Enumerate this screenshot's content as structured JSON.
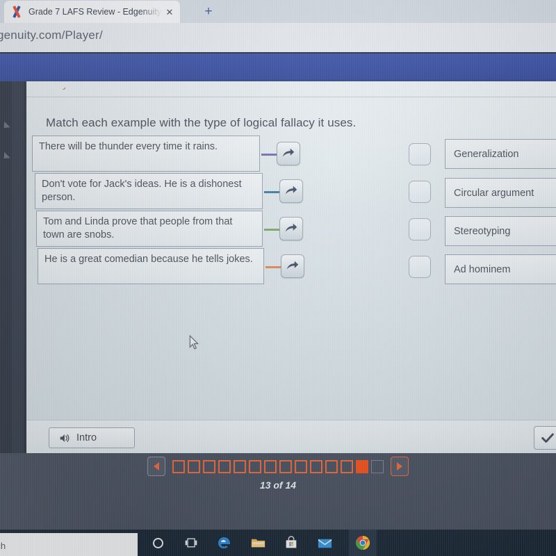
{
  "browser": {
    "tab": {
      "title": "Grade 7 LAFS Review - Edgenuity",
      "favicon": "edgenuity-x-icon",
      "close_label": "✕"
    },
    "new_tab_label": "+",
    "url": "genuity.com/Player/"
  },
  "activity": {
    "prompt": "Match each example with the type of logical fallacy it uses.",
    "examples": [
      {
        "text": "There will be thunder every time it rains.",
        "connector_color": "#7b6fb5"
      },
      {
        "text": "Don't vote for Jack's ideas. He is a dishonest person.",
        "connector_color": "#3f7fa6"
      },
      {
        "text": "Tom and Linda prove that people from that town are snobs.",
        "connector_color": "#7fab6b"
      },
      {
        "text": "He is a great comedian because he tells jokes.",
        "connector_color": "#e08b56"
      }
    ],
    "answers": [
      {
        "label": "Generalization"
      },
      {
        "label": "Circular argument"
      },
      {
        "label": "Stereotyping"
      },
      {
        "label": "Ad hominem"
      }
    ],
    "footer": {
      "intro_label": "Intro",
      "intro_icon": "speaker-icon",
      "submit_icon": "checkmark-icon"
    }
  },
  "navigation": {
    "prev_icon": "triangle-left-icon",
    "next_icon": "triangle-right-icon",
    "page_label": "13 of 14",
    "current_page": 13,
    "total_pages": 14,
    "accent_color": "#ef6b3c",
    "current_fill_color": "#f4541f",
    "pips": [
      "visited",
      "visited",
      "visited",
      "visited",
      "visited",
      "visited",
      "visited",
      "visited",
      "visited",
      "visited",
      "visited",
      "visited",
      "current",
      "locked"
    ]
  },
  "taskbar": {
    "search_text": "rch",
    "icons": [
      "cortana-circle-icon",
      "task-view-icon",
      "edge-browser-icon",
      "file-explorer-icon",
      "microsoft-store-icon",
      "mail-icon",
      "chrome-browser-icon"
    ]
  }
}
